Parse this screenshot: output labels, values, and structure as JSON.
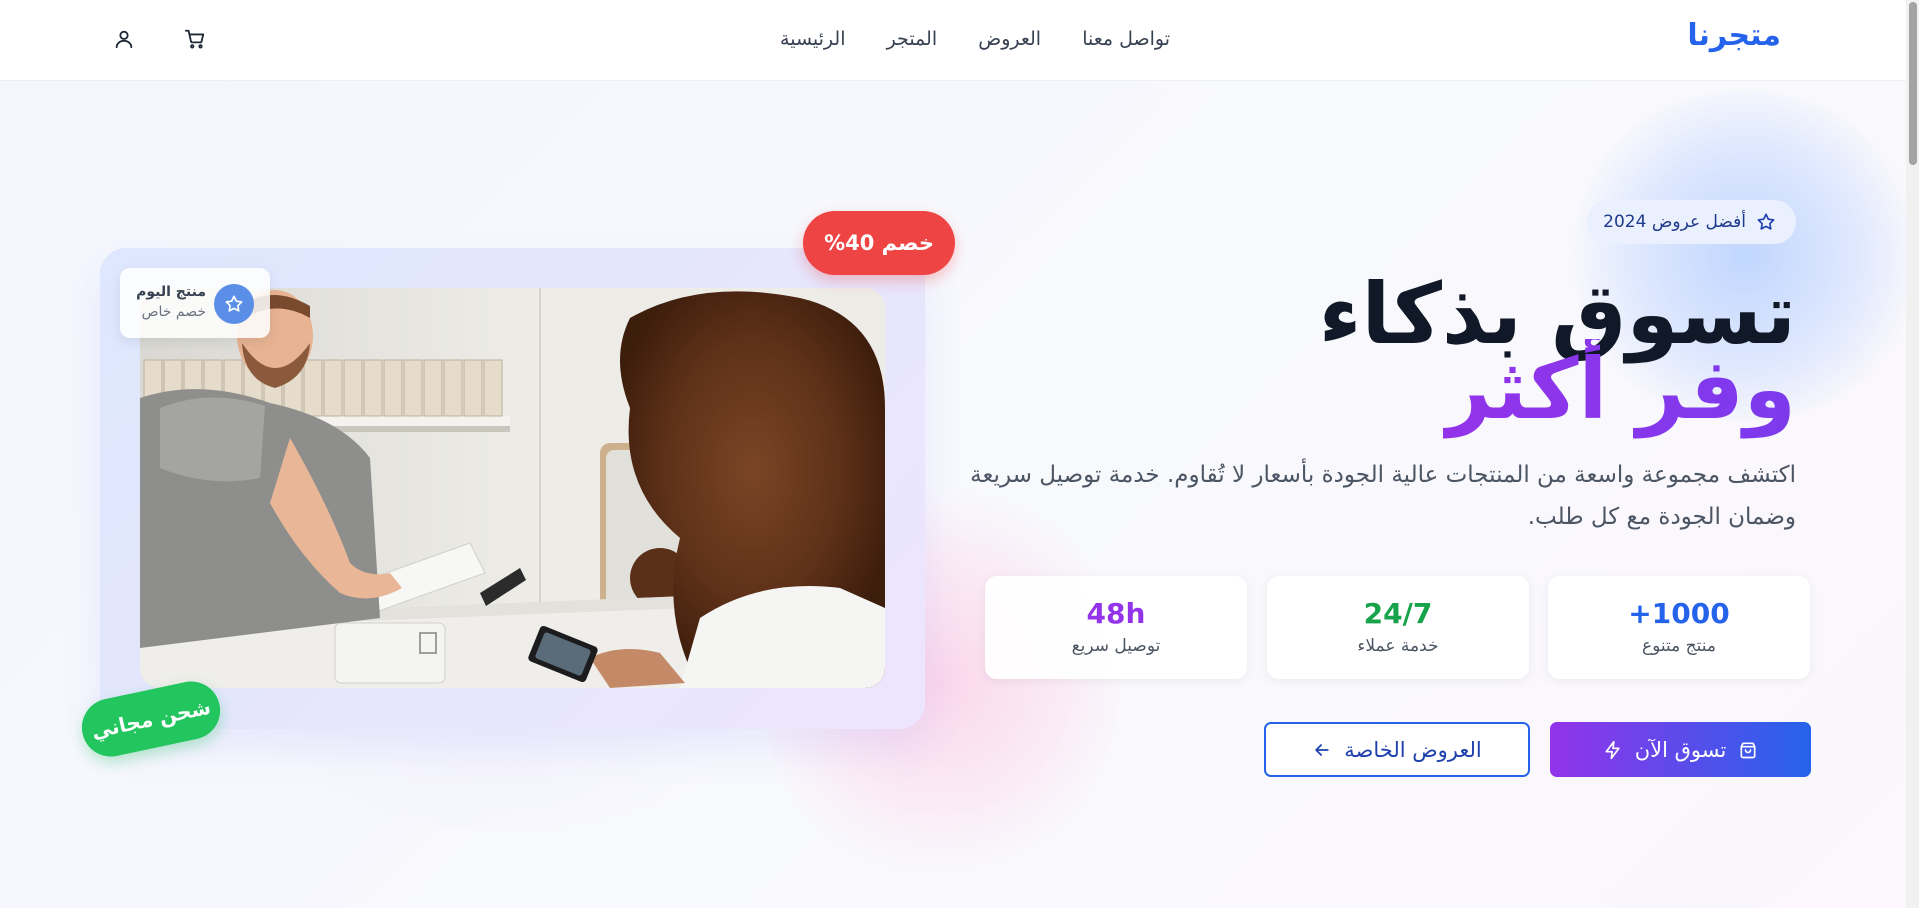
{
  "header": {
    "logo": "متجرنا",
    "nav": [
      "الرئيسية",
      "المتجر",
      "العروض",
      "تواصل معنا"
    ],
    "icons": [
      "cart-icon",
      "user-icon"
    ]
  },
  "hero": {
    "badge": "أفضل عروض 2024",
    "headline_line1": "تسوق بذكاء",
    "headline_line2": "وفر أكثر",
    "description": "اكتشف مجموعة واسعة من المنتجات عالية الجودة بأسعار لا تُقاوم. خدمة توصيل سريعة وضمان الجودة مع كل طلب.",
    "stats": [
      {
        "value": "+1000",
        "label": "منتج متنوع",
        "color": "#2563eb"
      },
      {
        "value": "24/7",
        "label": "خدمة عملاء",
        "color": "#16a34a"
      },
      {
        "value": "48h",
        "label": "توصيل سريع",
        "color": "#9333ea"
      }
    ],
    "primary_button": "تسوق الآن",
    "secondary_button": "العروض الخاصة"
  },
  "image_card": {
    "discount_badge": "خصم 40%",
    "daily_title": "منتج اليوم",
    "daily_subtitle": "خصم خاص",
    "shipping_badge": "شحن مجاني",
    "photo_icon": "shop-checkout-photo"
  },
  "colors": {
    "brand": "#2563eb",
    "accent_purple": "#9333ea",
    "success": "#22c55e",
    "danger": "#ef4444"
  }
}
